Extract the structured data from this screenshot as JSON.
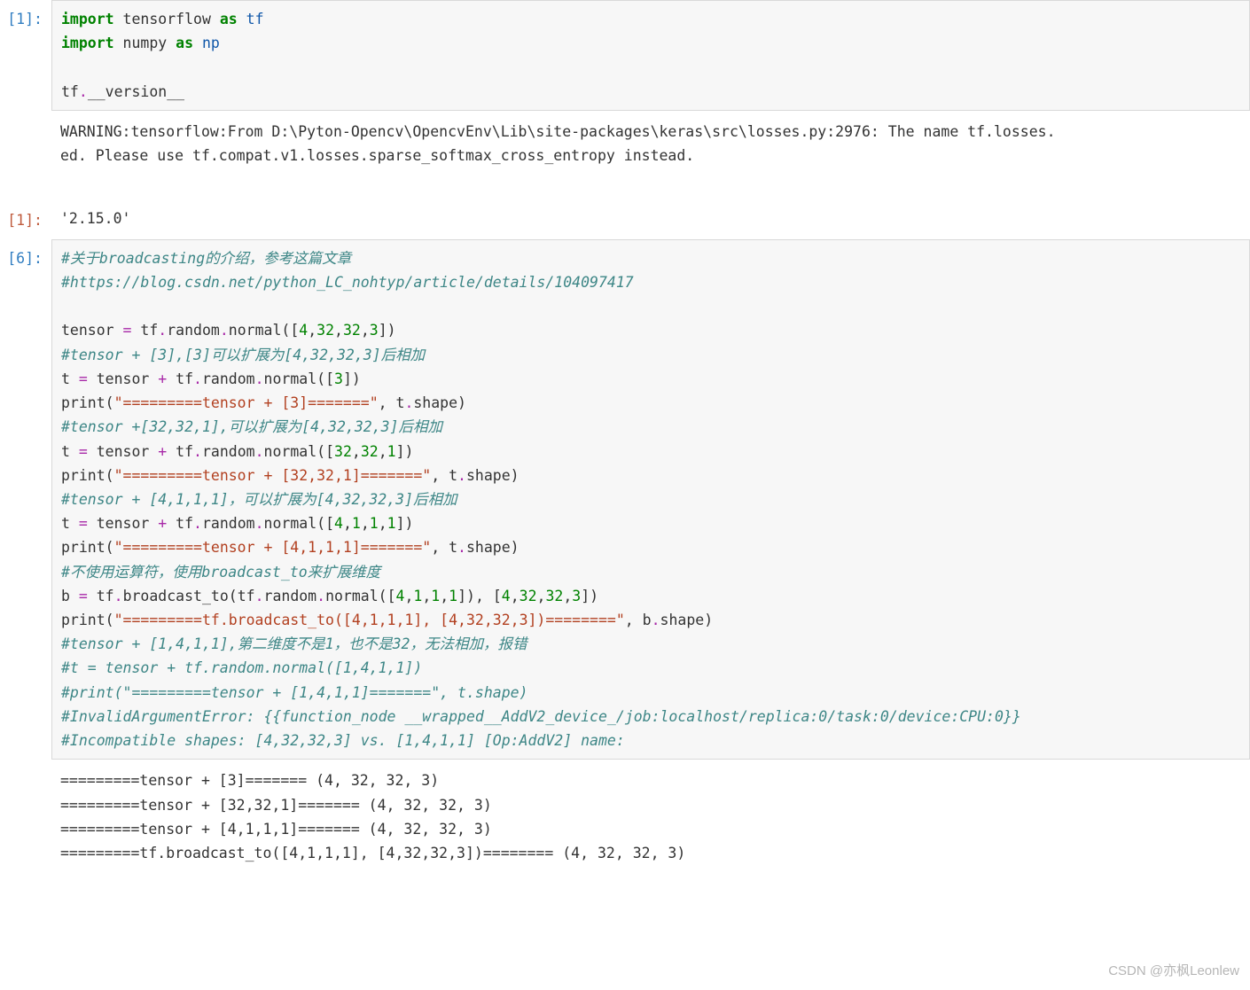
{
  "cells": {
    "c1": {
      "prompt": "[1]:",
      "code_tokens": [
        {
          "t": "import",
          "c": "kw"
        },
        {
          "t": " tensorflow ",
          "c": ""
        },
        {
          "t": "as",
          "c": "kw"
        },
        {
          "t": " ",
          "c": ""
        },
        {
          "t": "tf",
          "c": "nn"
        },
        {
          "t": "\n",
          "c": ""
        },
        {
          "t": "import",
          "c": "kw"
        },
        {
          "t": " numpy ",
          "c": ""
        },
        {
          "t": "as",
          "c": "kw"
        },
        {
          "t": " ",
          "c": ""
        },
        {
          "t": "np",
          "c": "nn"
        },
        {
          "t": "\n\n",
          "c": ""
        },
        {
          "t": "tf",
          "c": ""
        },
        {
          "t": ".",
          "c": "op"
        },
        {
          "t": "__version__",
          "c": ""
        }
      ],
      "warning": "WARNING:tensorflow:From D:\\Pyton-Opencv\\OpencvEnv\\Lib\\site-packages\\keras\\src\\losses.py:2976: The name tf.losses.\ned. Please use tf.compat.v1.losses.sparse_softmax_cross_entropy instead.\n ",
      "out_prompt": "[1]:",
      "result": "'2.15.0'"
    },
    "c2": {
      "prompt": "[6]:",
      "code_tokens": [
        {
          "t": "#关于broadcasting的介绍，参考这篇文章",
          "c": "cmt"
        },
        {
          "t": "\n",
          "c": ""
        },
        {
          "t": "#https://blog.csdn.net/python_LC_nohtyp/article/details/104097417",
          "c": "cmt"
        },
        {
          "t": "\n\n",
          "c": ""
        },
        {
          "t": "tensor ",
          "c": ""
        },
        {
          "t": "=",
          "c": "op"
        },
        {
          "t": " tf",
          "c": ""
        },
        {
          "t": ".",
          "c": "op"
        },
        {
          "t": "random",
          "c": ""
        },
        {
          "t": ".",
          "c": "op"
        },
        {
          "t": "normal(",
          "c": ""
        },
        {
          "t": "[",
          "c": ""
        },
        {
          "t": "4",
          "c": "num"
        },
        {
          "t": ",",
          "c": ""
        },
        {
          "t": "32",
          "c": "num"
        },
        {
          "t": ",",
          "c": ""
        },
        {
          "t": "32",
          "c": "num"
        },
        {
          "t": ",",
          "c": ""
        },
        {
          "t": "3",
          "c": "num"
        },
        {
          "t": "]",
          "c": ""
        },
        {
          "t": ")\n",
          "c": ""
        },
        {
          "t": "#tensor + [3],[3]可以扩展为[4,32,32,3]后相加",
          "c": "cmt"
        },
        {
          "t": "\n",
          "c": ""
        },
        {
          "t": "t ",
          "c": ""
        },
        {
          "t": "=",
          "c": "op"
        },
        {
          "t": " tensor ",
          "c": ""
        },
        {
          "t": "+",
          "c": "op"
        },
        {
          "t": " tf",
          "c": ""
        },
        {
          "t": ".",
          "c": "op"
        },
        {
          "t": "random",
          "c": ""
        },
        {
          "t": ".",
          "c": "op"
        },
        {
          "t": "normal(",
          "c": ""
        },
        {
          "t": "[",
          "c": ""
        },
        {
          "t": "3",
          "c": "num"
        },
        {
          "t": "]",
          "c": ""
        },
        {
          "t": ")\n",
          "c": ""
        },
        {
          "t": "print",
          "c": "fn"
        },
        {
          "t": "(",
          "c": ""
        },
        {
          "t": "\"=========tensor + [3]=======\"",
          "c": "str"
        },
        {
          "t": ", t",
          "c": ""
        },
        {
          "t": ".",
          "c": "op"
        },
        {
          "t": "shape)\n",
          "c": ""
        },
        {
          "t": "#tensor +[32,32,1],可以扩展为[4,32,32,3]后相加",
          "c": "cmt"
        },
        {
          "t": "\n",
          "c": ""
        },
        {
          "t": "t ",
          "c": ""
        },
        {
          "t": "=",
          "c": "op"
        },
        {
          "t": " tensor ",
          "c": ""
        },
        {
          "t": "+",
          "c": "op"
        },
        {
          "t": " tf",
          "c": ""
        },
        {
          "t": ".",
          "c": "op"
        },
        {
          "t": "random",
          "c": ""
        },
        {
          "t": ".",
          "c": "op"
        },
        {
          "t": "normal(",
          "c": ""
        },
        {
          "t": "[",
          "c": ""
        },
        {
          "t": "32",
          "c": "num"
        },
        {
          "t": ",",
          "c": ""
        },
        {
          "t": "32",
          "c": "num"
        },
        {
          "t": ",",
          "c": ""
        },
        {
          "t": "1",
          "c": "num"
        },
        {
          "t": "]",
          "c": ""
        },
        {
          "t": ")\n",
          "c": ""
        },
        {
          "t": "print",
          "c": "fn"
        },
        {
          "t": "(",
          "c": ""
        },
        {
          "t": "\"=========tensor + [32,32,1]=======\"",
          "c": "str"
        },
        {
          "t": ", t",
          "c": ""
        },
        {
          "t": ".",
          "c": "op"
        },
        {
          "t": "shape)\n",
          "c": ""
        },
        {
          "t": "#tensor + [4,1,1,1]，可以扩展为[4,32,32,3]后相加",
          "c": "cmt"
        },
        {
          "t": "\n",
          "c": ""
        },
        {
          "t": "t ",
          "c": ""
        },
        {
          "t": "=",
          "c": "op"
        },
        {
          "t": " tensor ",
          "c": ""
        },
        {
          "t": "+",
          "c": "op"
        },
        {
          "t": " tf",
          "c": ""
        },
        {
          "t": ".",
          "c": "op"
        },
        {
          "t": "random",
          "c": ""
        },
        {
          "t": ".",
          "c": "op"
        },
        {
          "t": "normal(",
          "c": ""
        },
        {
          "t": "[",
          "c": ""
        },
        {
          "t": "4",
          "c": "num"
        },
        {
          "t": ",",
          "c": ""
        },
        {
          "t": "1",
          "c": "num"
        },
        {
          "t": ",",
          "c": ""
        },
        {
          "t": "1",
          "c": "num"
        },
        {
          "t": ",",
          "c": ""
        },
        {
          "t": "1",
          "c": "num"
        },
        {
          "t": "]",
          "c": ""
        },
        {
          "t": ")\n",
          "c": ""
        },
        {
          "t": "print",
          "c": "fn"
        },
        {
          "t": "(",
          "c": ""
        },
        {
          "t": "\"=========tensor + [4,1,1,1]=======\"",
          "c": "str"
        },
        {
          "t": ", t",
          "c": ""
        },
        {
          "t": ".",
          "c": "op"
        },
        {
          "t": "shape)\n",
          "c": ""
        },
        {
          "t": "#不使用运算符，使用broadcast_to来扩展维度",
          "c": "cmt"
        },
        {
          "t": "\n",
          "c": ""
        },
        {
          "t": "b ",
          "c": ""
        },
        {
          "t": "=",
          "c": "op"
        },
        {
          "t": " tf",
          "c": ""
        },
        {
          "t": ".",
          "c": "op"
        },
        {
          "t": "broadcast_to(tf",
          "c": ""
        },
        {
          "t": ".",
          "c": "op"
        },
        {
          "t": "random",
          "c": ""
        },
        {
          "t": ".",
          "c": "op"
        },
        {
          "t": "normal(",
          "c": ""
        },
        {
          "t": "[",
          "c": ""
        },
        {
          "t": "4",
          "c": "num"
        },
        {
          "t": ",",
          "c": ""
        },
        {
          "t": "1",
          "c": "num"
        },
        {
          "t": ",",
          "c": ""
        },
        {
          "t": "1",
          "c": "num"
        },
        {
          "t": ",",
          "c": ""
        },
        {
          "t": "1",
          "c": "num"
        },
        {
          "t": "]",
          "c": ""
        },
        {
          "t": "), ",
          "c": ""
        },
        {
          "t": "[",
          "c": ""
        },
        {
          "t": "4",
          "c": "num"
        },
        {
          "t": ",",
          "c": ""
        },
        {
          "t": "32",
          "c": "num"
        },
        {
          "t": ",",
          "c": ""
        },
        {
          "t": "32",
          "c": "num"
        },
        {
          "t": ",",
          "c": ""
        },
        {
          "t": "3",
          "c": "num"
        },
        {
          "t": "]",
          "c": ""
        },
        {
          "t": ")\n",
          "c": ""
        },
        {
          "t": "print",
          "c": "fn"
        },
        {
          "t": "(",
          "c": ""
        },
        {
          "t": "\"=========tf.broadcast_to([4,1,1,1], [4,32,32,3])========\"",
          "c": "str"
        },
        {
          "t": ", b",
          "c": ""
        },
        {
          "t": ".",
          "c": "op"
        },
        {
          "t": "shape)\n",
          "c": ""
        },
        {
          "t": "#tensor + [1,4,1,1],第二维度不是1，也不是32，无法相加，报错",
          "c": "cmt"
        },
        {
          "t": "\n",
          "c": ""
        },
        {
          "t": "#t = tensor + tf.random.normal([1,4,1,1])",
          "c": "cmt"
        },
        {
          "t": "\n",
          "c": ""
        },
        {
          "t": "#print(\"=========tensor + [1,4,1,1]=======\", t.shape)",
          "c": "cmt"
        },
        {
          "t": "\n",
          "c": ""
        },
        {
          "t": "#InvalidArgumentError: {{function_node __wrapped__AddV2_device_/job:localhost/replica:0/task:0/device:CPU:0}}",
          "c": "cmt"
        },
        {
          "t": "\n",
          "c": ""
        },
        {
          "t": "#Incompatible shapes: [4,32,32,3] vs. [1,4,1,1] [Op:AddV2] name:",
          "c": "cmt"
        }
      ],
      "stdout": "=========tensor + [3]======= (4, 32, 32, 3)\n=========tensor + [32,32,1]======= (4, 32, 32, 3)\n=========tensor + [4,1,1,1]======= (4, 32, 32, 3)\n=========tf.broadcast_to([4,1,1,1], [4,32,32,3])======== (4, 32, 32, 3)"
    }
  },
  "watermark": "CSDN @亦枫Leonlew"
}
